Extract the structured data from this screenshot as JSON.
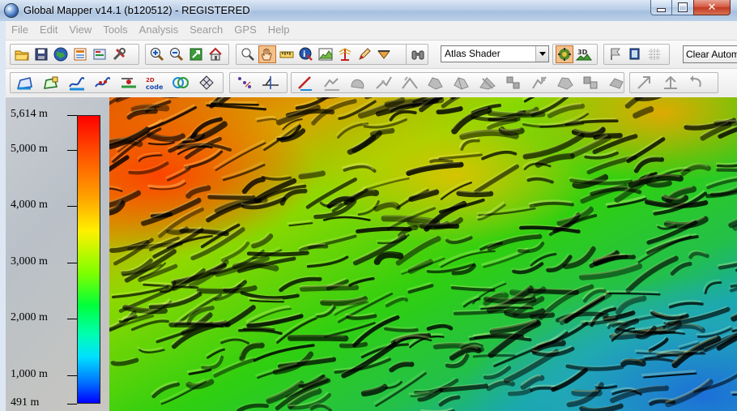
{
  "window": {
    "title": "Global Mapper v14.1 (b120512) - REGISTERED",
    "close_glyph": "✕"
  },
  "menu": [
    "File",
    "Edit",
    "View",
    "Tools",
    "Analysis",
    "Search",
    "GPS",
    "Help"
  ],
  "toolbar": {
    "shader_value": "Atlas Shader",
    "clear_auto_label": "Clear Autom",
    "icons_row1": [
      "open-folder-icon",
      "save-icon",
      "globe-icon",
      "layer-control-icon",
      "config-icon",
      "tools-icon",
      "zoom-in-icon",
      "zoom-out-icon",
      "zoom-extents-icon",
      "home-icon",
      "zoom-tool-icon",
      "pan-hand-icon",
      "measure-icon",
      "feature-info-icon",
      "path-profile-icon",
      "view-shed-icon",
      "digitizer-icon",
      "3d-path-icon",
      "binoculars-icon"
    ],
    "icons_row2": [
      "create-area-icon",
      "edit-area-icon",
      "create-line-icon",
      "edit-line-icon",
      "create-point-icon",
      "code-icon",
      "buffer-icon",
      "grid-icon",
      "vertex-select-icon",
      "line-split-icon",
      "draw-line-icon",
      "move-icon",
      "reshape-icon",
      "smooth-icon",
      "rotate-icon",
      "combine-icon",
      "split-area-icon",
      "cut-icon",
      "insert-vertex-icon",
      "delete-vertex-icon",
      "crop-icon",
      "union-icon",
      "intersect-icon",
      "difference-icon",
      "arrow-up-right-icon",
      "arrow-up-icon",
      "undo-arrow-icon"
    ]
  },
  "legend": {
    "labels": [
      {
        "text": "5,614 m",
        "value": 5614
      },
      {
        "text": "5,000 m",
        "value": 5000
      },
      {
        "text": "4,000 m",
        "value": 4000
      },
      {
        "text": "3,000 m",
        "value": 3000
      },
      {
        "text": "2,000 m",
        "value": 2000
      },
      {
        "text": "1,000 m",
        "value": 1000
      },
      {
        "text": "491 m",
        "value": 491
      }
    ],
    "max": 5614,
    "min": 491,
    "colors": [
      "#ff0000",
      "#ffa000",
      "#fff000",
      "#00ff3a",
      "#00e0ff",
      "#0000ff"
    ]
  }
}
